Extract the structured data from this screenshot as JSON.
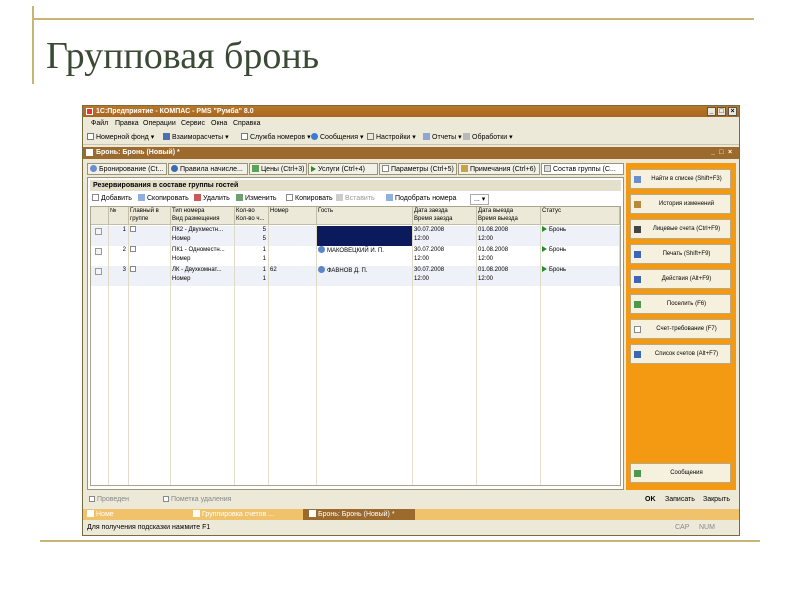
{
  "slide": {
    "title": "Групповая бронь"
  },
  "app": {
    "title": "1С:Предприятие - КОМПАС - PMS \"Румба\" 8.0",
    "menu": [
      "Файл",
      "Правка",
      "Операции",
      "Сервис",
      "Окна",
      "Справка"
    ],
    "toolbar": [
      "Номерной фонд",
      "Взаиморасчеты",
      "Служба номеров",
      "Сообщения",
      "Настройки",
      "Отчеты",
      "Обработки"
    ],
    "document_title": "Бронь: Бронь (Новый) *",
    "tabs": [
      "Бронирование (Ct...",
      "Правила начисле...",
      "Цены (Ctrl+3)",
      "Услуги (Ctrl+4)",
      "Параметры (Ctrl+5)",
      "Примечания (Ctrl+6)",
      "Состав группы (C..."
    ],
    "section_title": "Резервирования в составе группы гостей",
    "grid_toolbar": [
      "Добавить",
      "Скопировать",
      "Удалить",
      "Изменить",
      "Копировать",
      "Вставить",
      "Подобрать номера",
      "..."
    ],
    "columns": [
      {
        "top": "№",
        "bottom": ""
      },
      {
        "top": "Главный в",
        "bottom": "группе"
      },
      {
        "top": "Тип номера",
        "bottom": "Вид размещения"
      },
      {
        "top": "Кол-во",
        "bottom": "Кол-во ч..."
      },
      {
        "top": "Номер",
        "bottom": ""
      },
      {
        "top": "Гость",
        "bottom": ""
      },
      {
        "top": "Дата заезда",
        "bottom": "Время заезда"
      },
      {
        "top": "Дата выезда",
        "bottom": "Время выезда"
      },
      {
        "top": "Статус",
        "bottom": ""
      }
    ],
    "rows": [
      {
        "num": "1",
        "type": "ПК2 - Двухместн...",
        "placement": "Номер",
        "qty": "5",
        "qty_h": "5",
        "room": "",
        "guest": "",
        "date_in": "30.07.2008",
        "time_in": "12:00",
        "date_out": "01.08.2008",
        "time_out": "12:00",
        "status": "Бронь"
      },
      {
        "num": "2",
        "type": "ПК1 - Одноместн...",
        "placement": "Номер",
        "qty": "1",
        "qty_h": "1",
        "room": "",
        "guest": "МАКОВЕЦКИЙ И. П.",
        "date_in": "30.07.2008",
        "time_in": "12:00",
        "date_out": "01.08.2008",
        "time_out": "12:00",
        "status": "Бронь"
      },
      {
        "num": "3",
        "type": "ЛК - Двухкомнат...",
        "placement": "Номер",
        "qty": "1",
        "qty_h": "1",
        "room": "62",
        "guest": "ФАВНОВ Д. П.",
        "date_in": "30.07.2008",
        "time_in": "12:00",
        "date_out": "01.08.2008",
        "time_out": "12:00",
        "status": "Бронь"
      }
    ],
    "right_buttons": [
      "Найти в списке (Shift+F3)",
      "История изменений",
      "Лицевые счета (Ctrl+F9)",
      "Печать (Shift+F9)",
      "Действия (Alt+F9)",
      "Поселить (F6)",
      "Счет-требование (F7)",
      "Список счетов (Alt+F7)",
      "Сообщения"
    ],
    "bottom": {
      "checkbox1": "Проведен",
      "checkbox2": "Пометка удаления",
      "ok": "OK",
      "save": "Записать",
      "close": "Закрыть"
    },
    "taskbar": [
      "Номе",
      "Группировка счетов ...",
      "Бронь: Бронь (Новый) *"
    ],
    "status": {
      "hint": "Для получения подсказки нажмите F1",
      "cap": "CAP",
      "num": "NUM"
    },
    "colors": {
      "accent": "#f49a12",
      "titlebar": "#a86520",
      "selected_cell": "#0a1a5c"
    }
  }
}
